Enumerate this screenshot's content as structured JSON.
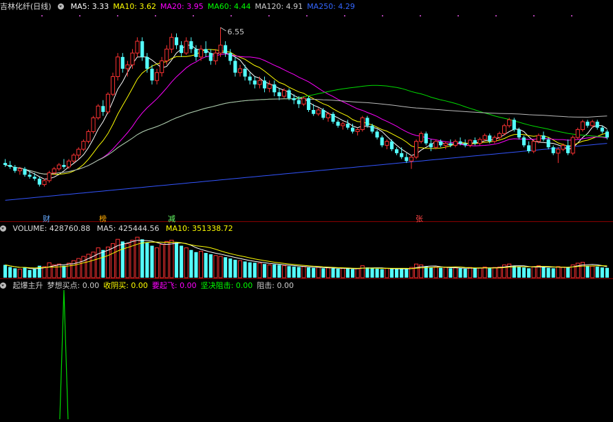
{
  "main": {
    "title": "吉林化纤(日线)",
    "ma": [
      {
        "label": "MA5: 3.33",
        "color": "#ffffff"
      },
      {
        "label": "MA10: 3.62",
        "color": "#ffff00"
      },
      {
        "label": "MA20: 3.95",
        "color": "#ff00ff"
      },
      {
        "label": "MA60: 4.44",
        "color": "#00ff00"
      },
      {
        "label": "MA120: 4.91",
        "color": "#cccccc"
      },
      {
        "label": "MA250: 4.29",
        "color": "#3366ff"
      }
    ],
    "high_label": "6.55",
    "tags": [
      {
        "text": "财",
        "color": "#66aaff"
      },
      {
        "text": "榜",
        "color": "#ffaa00"
      },
      {
        "text": "减",
        "color": "#66ff66"
      },
      {
        "text": "张",
        "color": "#ff4444"
      }
    ]
  },
  "volume": {
    "label": "VOLUME: 428760.88",
    "ma5": "MA5: 425444.56",
    "ma10": "MA10: 351338.72"
  },
  "indicator": {
    "items": [
      {
        "label": "起爆主升",
        "color": "#cccccc"
      },
      {
        "label": "梦想买点: 0.00",
        "color": "#cccccc"
      },
      {
        "label": "收阴买: 0.00",
        "color": "#ffff00"
      },
      {
        "label": "要起飞: 0.00",
        "color": "#ff00ff"
      },
      {
        "label": "坚决阻击: 0.00",
        "color": "#00ff00"
      },
      {
        "label": "阻击: 0.00",
        "color": "#cccccc"
      }
    ]
  },
  "chart_data": {
    "type": "candlestick",
    "price_range": [
      2.0,
      6.9
    ],
    "candles": [
      [
        3.1,
        3.2,
        3.0,
        3.05
      ],
      [
        3.05,
        3.15,
        2.95,
        3.0
      ],
      [
        3.0,
        3.05,
        2.85,
        2.9
      ],
      [
        2.9,
        3.0,
        2.8,
        2.95
      ],
      [
        2.95,
        3.0,
        2.75,
        2.8
      ],
      [
        2.8,
        2.9,
        2.7,
        2.75
      ],
      [
        2.75,
        2.85,
        2.65,
        2.7
      ],
      [
        2.7,
        2.75,
        2.5,
        2.55
      ],
      [
        2.55,
        2.7,
        2.5,
        2.65
      ],
      [
        2.65,
        2.9,
        2.6,
        2.85
      ],
      [
        2.85,
        3.0,
        2.8,
        2.95
      ],
      [
        2.95,
        3.1,
        2.9,
        3.05
      ],
      [
        3.05,
        3.2,
        2.95,
        3.0
      ],
      [
        3.0,
        3.2,
        2.95,
        3.15
      ],
      [
        3.15,
        3.35,
        3.1,
        3.3
      ],
      [
        3.3,
        3.5,
        3.2,
        3.45
      ],
      [
        3.45,
        3.7,
        3.4,
        3.65
      ],
      [
        3.65,
        3.95,
        3.6,
        3.9
      ],
      [
        3.9,
        4.3,
        3.85,
        4.25
      ],
      [
        4.25,
        4.6,
        4.2,
        4.55
      ],
      [
        4.55,
        4.7,
        4.3,
        4.4
      ],
      [
        4.4,
        4.9,
        4.35,
        4.85
      ],
      [
        4.85,
        5.4,
        4.8,
        5.3
      ],
      [
        5.3,
        5.9,
        5.2,
        5.8
      ],
      [
        5.8,
        5.9,
        5.4,
        5.5
      ],
      [
        5.5,
        5.7,
        5.3,
        5.6
      ],
      [
        5.6,
        6.0,
        5.5,
        5.9
      ],
      [
        5.9,
        6.3,
        5.8,
        6.2
      ],
      [
        6.2,
        6.3,
        5.7,
        5.8
      ],
      [
        5.8,
        5.9,
        5.4,
        5.5
      ],
      [
        5.5,
        5.6,
        5.1,
        5.2
      ],
      [
        5.2,
        5.5,
        5.1,
        5.4
      ],
      [
        5.4,
        5.8,
        5.3,
        5.7
      ],
      [
        5.7,
        6.1,
        5.6,
        6.0
      ],
      [
        6.0,
        6.4,
        5.9,
        6.3
      ],
      [
        6.3,
        6.4,
        6.0,
        6.1
      ],
      [
        6.1,
        6.2,
        5.8,
        5.9
      ],
      [
        5.9,
        6.3,
        5.85,
        6.2
      ],
      [
        6.2,
        6.3,
        5.9,
        6.0
      ],
      [
        6.0,
        6.1,
        5.7,
        5.8
      ],
      [
        5.8,
        6.1,
        5.7,
        6.0
      ],
      [
        6.0,
        6.2,
        5.8,
        5.9
      ],
      [
        5.9,
        6.0,
        5.6,
        5.7
      ],
      [
        5.7,
        6.0,
        5.6,
        5.9
      ],
      [
        5.9,
        6.55,
        5.8,
        6.1
      ],
      [
        6.1,
        6.2,
        5.8,
        5.9
      ],
      [
        5.9,
        6.0,
        5.6,
        5.7
      ],
      [
        5.7,
        5.8,
        5.3,
        5.4
      ],
      [
        5.4,
        5.6,
        5.3,
        5.5
      ],
      [
        5.5,
        5.6,
        5.2,
        5.3
      ],
      [
        5.3,
        5.4,
        5.1,
        5.2
      ],
      [
        5.2,
        5.3,
        5.0,
        5.1
      ],
      [
        5.1,
        5.3,
        5.0,
        5.2
      ],
      [
        5.2,
        5.3,
        4.9,
        5.0
      ],
      [
        5.0,
        5.2,
        4.9,
        5.1
      ],
      [
        5.1,
        5.2,
        4.8,
        4.9
      ],
      [
        4.9,
        5.0,
        4.7,
        4.8
      ],
      [
        4.8,
        5.0,
        4.75,
        4.95
      ],
      [
        4.95,
        5.0,
        4.7,
        4.75
      ],
      [
        4.75,
        4.85,
        4.6,
        4.7
      ],
      [
        4.7,
        4.8,
        4.5,
        4.6
      ],
      [
        4.6,
        4.8,
        4.55,
        4.75
      ],
      [
        4.75,
        4.8,
        4.4,
        4.45
      ],
      [
        4.45,
        4.6,
        4.3,
        4.35
      ],
      [
        4.35,
        4.5,
        4.3,
        4.45
      ],
      [
        4.45,
        4.5,
        4.2,
        4.25
      ],
      [
        4.25,
        4.4,
        4.15,
        4.35
      ],
      [
        4.35,
        4.4,
        4.1,
        4.15
      ],
      [
        4.15,
        4.2,
        4.0,
        4.05
      ],
      [
        4.05,
        4.15,
        3.95,
        4.1
      ],
      [
        4.1,
        4.2,
        3.95,
        4.0
      ],
      [
        4.0,
        4.1,
        3.85,
        3.9
      ],
      [
        3.9,
        4.0,
        3.8,
        3.95
      ],
      [
        3.95,
        4.3,
        3.9,
        4.25
      ],
      [
        4.25,
        4.3,
        4.0,
        4.05
      ],
      [
        4.05,
        4.1,
        3.85,
        3.9
      ],
      [
        3.9,
        3.95,
        3.7,
        3.75
      ],
      [
        3.75,
        3.8,
        3.5,
        3.55
      ],
      [
        3.55,
        3.7,
        3.45,
        3.65
      ],
      [
        3.65,
        3.7,
        3.4,
        3.45
      ],
      [
        3.45,
        3.5,
        3.3,
        3.35
      ],
      [
        3.35,
        3.5,
        3.2,
        3.25
      ],
      [
        3.25,
        3.35,
        3.1,
        3.15
      ],
      [
        3.15,
        3.3,
        2.95,
        3.25
      ],
      [
        3.25,
        3.7,
        3.2,
        3.65
      ],
      [
        3.65,
        3.9,
        3.6,
        3.85
      ],
      [
        3.85,
        3.9,
        3.55,
        3.6
      ],
      [
        3.6,
        3.7,
        3.4,
        3.5
      ],
      [
        3.5,
        3.7,
        3.45,
        3.65
      ],
      [
        3.65,
        3.7,
        3.5,
        3.55
      ],
      [
        3.55,
        3.65,
        3.45,
        3.6
      ],
      [
        3.6,
        3.7,
        3.5,
        3.55
      ],
      [
        3.55,
        3.7,
        3.5,
        3.65
      ],
      [
        3.65,
        3.75,
        3.55,
        3.6
      ],
      [
        3.6,
        3.7,
        3.5,
        3.55
      ],
      [
        3.55,
        3.7,
        3.5,
        3.68
      ],
      [
        3.68,
        3.75,
        3.55,
        3.6
      ],
      [
        3.6,
        3.75,
        3.55,
        3.7
      ],
      [
        3.7,
        3.85,
        3.65,
        3.8
      ],
      [
        3.8,
        3.85,
        3.6,
        3.65
      ],
      [
        3.65,
        3.8,
        3.6,
        3.75
      ],
      [
        3.75,
        3.9,
        3.7,
        3.85
      ],
      [
        3.85,
        4.1,
        3.8,
        4.05
      ],
      [
        4.05,
        4.25,
        4.0,
        4.2
      ],
      [
        4.2,
        4.25,
        3.9,
        3.95
      ],
      [
        3.95,
        4.0,
        3.7,
        3.75
      ],
      [
        3.75,
        3.8,
        3.5,
        3.55
      ],
      [
        3.55,
        3.65,
        3.35,
        3.4
      ],
      [
        3.4,
        3.7,
        3.35,
        3.65
      ],
      [
        3.65,
        3.85,
        3.6,
        3.8
      ],
      [
        3.8,
        3.9,
        3.65,
        3.7
      ],
      [
        3.7,
        3.75,
        3.45,
        3.5
      ],
      [
        3.5,
        3.55,
        3.3,
        3.35
      ],
      [
        3.35,
        3.5,
        3.1,
        3.45
      ],
      [
        3.45,
        3.6,
        3.4,
        3.55
      ],
      [
        3.55,
        3.7,
        3.3,
        3.35
      ],
      [
        3.35,
        3.8,
        3.3,
        3.75
      ],
      [
        3.75,
        4.0,
        3.7,
        3.95
      ],
      [
        3.95,
        4.2,
        3.9,
        4.15
      ],
      [
        4.15,
        4.2,
        4.0,
        4.05
      ],
      [
        4.05,
        4.2,
        4.0,
        4.15
      ],
      [
        4.15,
        4.2,
        3.95,
        4.0
      ],
      [
        4.0,
        4.05,
        3.85,
        3.9
      ],
      [
        3.9,
        3.95,
        3.7,
        3.75
      ]
    ],
    "ma_values": {
      "MA5": [
        3.33
      ],
      "MA10": [
        3.62
      ],
      "MA20": [
        3.95
      ],
      "MA60": [
        4.44
      ],
      "MA120": [
        4.91
      ],
      "MA250": [
        4.29
      ]
    },
    "volume": [
      30,
      25,
      22,
      20,
      24,
      18,
      20,
      28,
      26,
      35,
      30,
      32,
      28,
      34,
      40,
      45,
      50,
      55,
      60,
      70,
      65,
      72,
      80,
      90,
      85,
      80,
      88,
      95,
      90,
      82,
      75,
      70,
      78,
      85,
      88,
      82,
      75,
      70,
      65,
      60,
      62,
      58,
      55,
      52,
      50,
      48,
      45,
      42,
      40,
      38,
      36,
      35,
      34,
      32,
      30,
      31,
      30,
      28,
      27,
      26,
      25,
      26,
      24,
      23,
      24,
      22,
      23,
      22,
      21,
      22,
      21,
      20,
      21,
      28,
      24,
      22,
      21,
      20,
      22,
      21,
      20,
      21,
      20,
      24,
      32,
      30,
      26,
      24,
      25,
      23,
      24,
      22,
      23,
      22,
      21,
      24,
      22,
      23,
      25,
      22,
      24,
      25,
      30,
      32,
      28,
      25,
      24,
      22,
      26,
      28,
      25,
      23,
      22,
      26,
      25,
      24,
      30,
      34,
      36,
      28,
      27,
      26,
      24,
      23
    ],
    "volume_range": [
      0,
      100
    ],
    "indicator_spike": {
      "index": 12,
      "value": 1
    }
  }
}
